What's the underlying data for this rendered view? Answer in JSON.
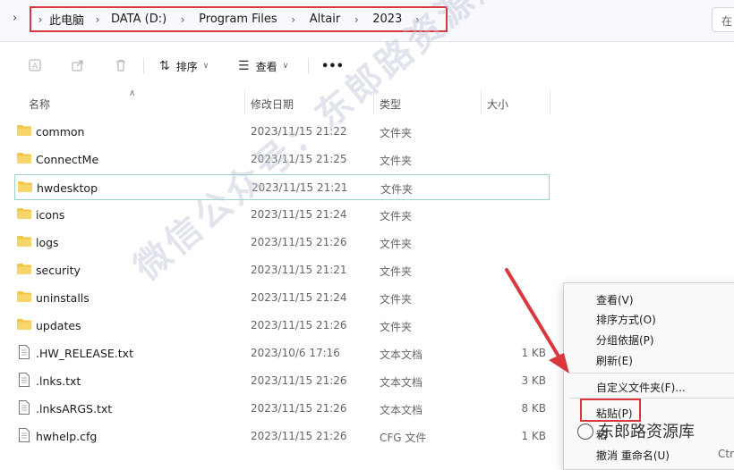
{
  "breadcrumb": [
    "此电脑",
    "DATA (D:)",
    "Program Files",
    "Altair",
    "2023"
  ],
  "search_placeholder": "在",
  "toolbar": {
    "sort_label": "排序",
    "view_label": "查看",
    "more_label": "•••"
  },
  "columns": {
    "name": "名称",
    "modified": "修改日期",
    "type": "类型",
    "size": "大小"
  },
  "files": [
    {
      "name": "common",
      "date": "2023/11/15 21:22",
      "type": "文件夹",
      "size": "",
      "kind": "folder"
    },
    {
      "name": "ConnectMe",
      "date": "2023/11/15 21:25",
      "type": "文件夹",
      "size": "",
      "kind": "folder"
    },
    {
      "name": "hwdesktop",
      "date": "2023/11/15 21:21",
      "type": "文件夹",
      "size": "",
      "kind": "folder",
      "selected": true
    },
    {
      "name": "icons",
      "date": "2023/11/15 21:24",
      "type": "文件夹",
      "size": "",
      "kind": "folder"
    },
    {
      "name": "logs",
      "date": "2023/11/15 21:26",
      "type": "文件夹",
      "size": "",
      "kind": "folder"
    },
    {
      "name": "security",
      "date": "2023/11/15 21:21",
      "type": "文件夹",
      "size": "",
      "kind": "folder"
    },
    {
      "name": "uninstalls",
      "date": "2023/11/15 21:24",
      "type": "文件夹",
      "size": "",
      "kind": "folder"
    },
    {
      "name": "updates",
      "date": "2023/11/15 21:26",
      "type": "文件夹",
      "size": "",
      "kind": "folder"
    },
    {
      "name": ".HW_RELEASE.txt",
      "date": "2023/10/6 17:16",
      "type": "文本文档",
      "size": "1 KB",
      "kind": "file"
    },
    {
      "name": ".lnks.txt",
      "date": "2023/11/15 21:26",
      "type": "文本文档",
      "size": "3 KB",
      "kind": "file"
    },
    {
      "name": ".lnksARGS.txt",
      "date": "2023/11/15 21:26",
      "type": "文本文档",
      "size": "8 KB",
      "kind": "file"
    },
    {
      "name": "hwhelp.cfg",
      "date": "2023/11/15 21:26",
      "type": "CFG 文件",
      "size": "1 KB",
      "kind": "file"
    }
  ],
  "context_menu": {
    "view": "查看(V)",
    "sort_by": "排序方式(O)",
    "group_by": "分组依据(P)",
    "refresh": "刷新(E)",
    "customize_folder": "自定义文件夹(F)...",
    "paste": "粘贴(P)",
    "paste_shortcut_partial": "粘",
    "undo_rename": "撤消 重命名(U)",
    "undo_shortcut": "Ctrl"
  },
  "watermark": {
    "main": "微信公众号：东郎路资源库",
    "corner": "东郎路资源库"
  },
  "colors": {
    "highlight_red": "#d9363e",
    "folder_yellow": "#f4c542",
    "selection_teal": "#9ad3cf"
  }
}
